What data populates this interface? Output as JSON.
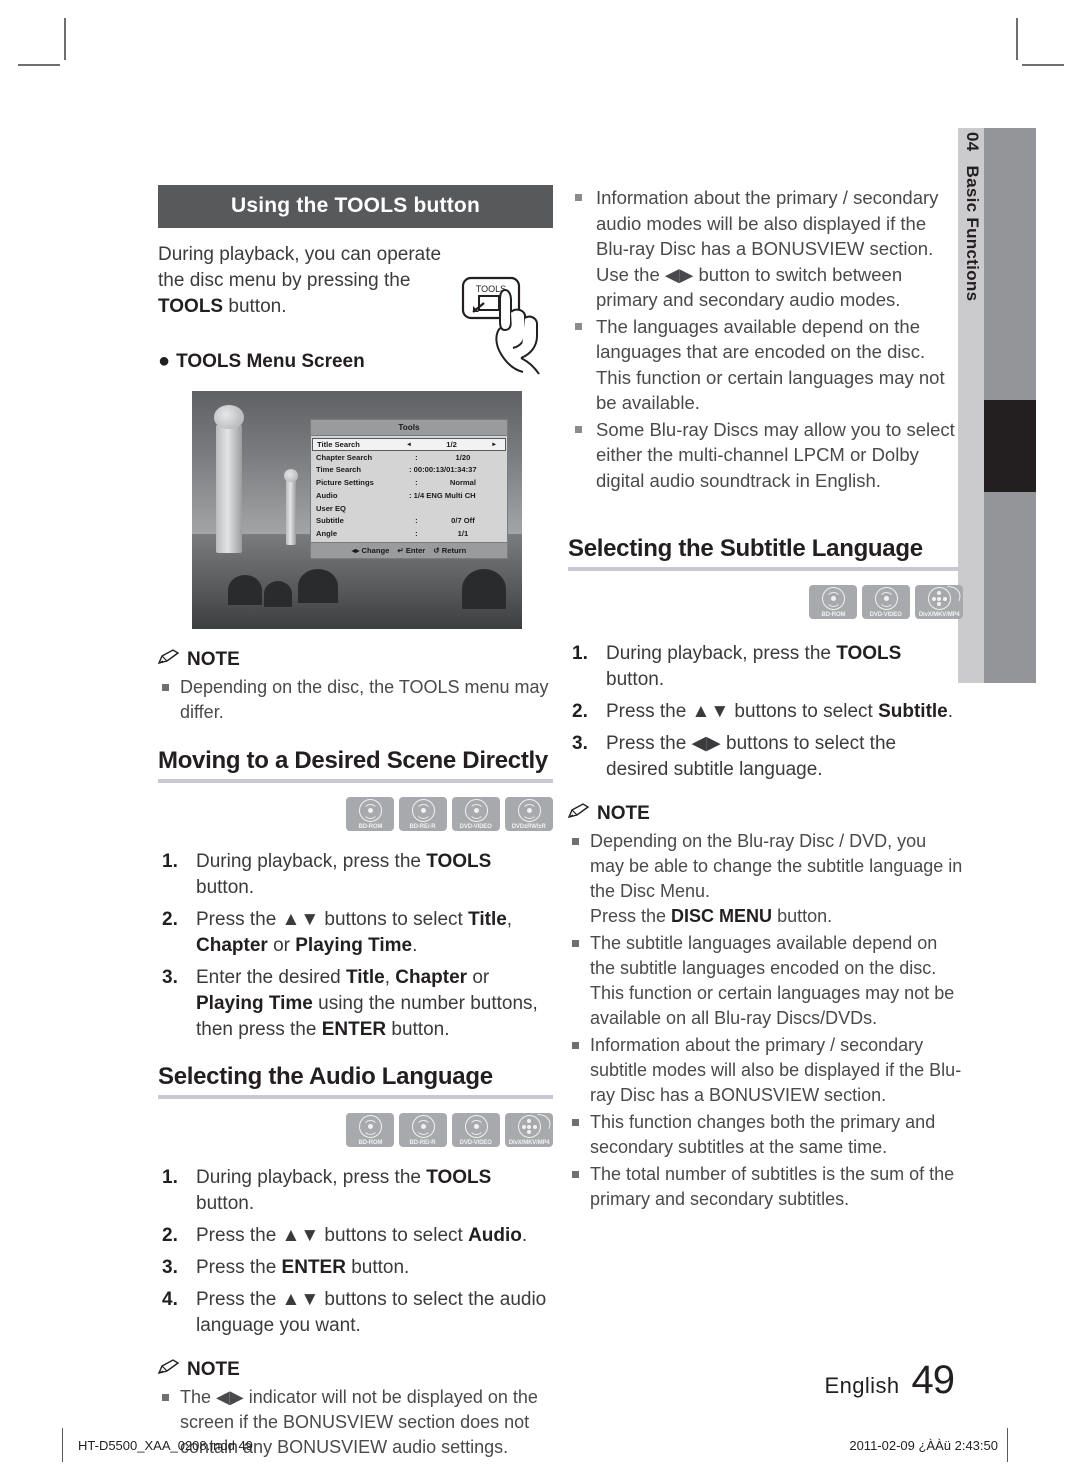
{
  "side_tab": {
    "number": "04",
    "label": "Basic Functions"
  },
  "left_column": {
    "bar_heading": "Using the TOOLS button",
    "intro_paragraph_1": "During playback, you can operate the disc menu by pressing the ",
    "intro_bold": "TOOLS",
    "intro_paragraph_2": " button.",
    "remote_button_label": "TOOLS",
    "sub_bullet": "TOOLS Menu Screen",
    "osd": {
      "title": "Tools",
      "rows": [
        {
          "label": "Title Search",
          "colon": "◂",
          "value": "1/2",
          "right_arrow": "▸",
          "selected": true
        },
        {
          "label": "Chapter Search",
          "colon": ":",
          "value": "1/20",
          "selected": false
        },
        {
          "label": "Time Search",
          "colon": "",
          "value": ": 00:00:13/01:34:37",
          "wide": true,
          "selected": false
        },
        {
          "label": "Picture Settings",
          "colon": ":",
          "value": "Normal",
          "selected": false
        },
        {
          "label": "Audio",
          "colon": "",
          "value": ": 1/4 ENG Multi CH",
          "wide": true,
          "selected": false
        },
        {
          "label": "User EQ",
          "colon": "",
          "value": "",
          "selected": false
        },
        {
          "label": "Subtitle",
          "colon": ":",
          "value": "0/7 Off",
          "selected": false
        },
        {
          "label": "Angle",
          "colon": ":",
          "value": "1/1",
          "selected": false
        }
      ],
      "footer_change": "◂▸ Change",
      "footer_enter": "↵ Enter",
      "footer_return": "↺ Return"
    },
    "note_1": {
      "title": "NOTE",
      "items": [
        "Depending on the disc, the TOOLS menu may differ."
      ]
    },
    "heading_moving": "Moving to a Desired Scene Directly",
    "discs_moving": [
      {
        "caption": "BD-ROM",
        "type": "disc"
      },
      {
        "caption": "BD-RE/-R",
        "type": "disc"
      },
      {
        "caption": "DVD-VIDEO",
        "type": "disc"
      },
      {
        "caption": "DVD±RW/±R",
        "type": "disc"
      }
    ],
    "steps_moving": [
      {
        "num": "1.",
        "html": "During playback, press the <b>TOOLS</b> button."
      },
      {
        "num": "2.",
        "html": "Press the ▲▼ buttons to select <b>Title</b>, <b>Chapter</b> or <b>Playing Time</b>."
      },
      {
        "num": "3.",
        "html": "Enter the desired <b>Title</b>, <b>Chapter</b> or <b>Playing Time</b> using the number buttons, then press the <b>ENTER</b> button."
      }
    ],
    "heading_audio": "Selecting the Audio Language",
    "discs_audio": [
      {
        "caption": "BD-ROM",
        "type": "disc"
      },
      {
        "caption": "BD-RE/-R",
        "type": "disc"
      },
      {
        "caption": "DVD-VIDEO",
        "type": "disc"
      },
      {
        "caption": "DivX/MKV/MP4",
        "type": "film"
      }
    ],
    "steps_audio": [
      {
        "num": "1.",
        "html": "During playback, press the <b>TOOLS</b> button."
      },
      {
        "num": "2.",
        "html": "Press the ▲▼ buttons to select <b>Audio</b>."
      },
      {
        "num": "3.",
        "html": "Press the <b>ENTER</b> button."
      },
      {
        "num": "4.",
        "html": "Press the ▲▼ buttons to select the audio language you want."
      }
    ],
    "note_2": {
      "title": "NOTE",
      "items": [
        "The ◀▶ indicator will not be displayed on the screen if the BONUSVIEW section does not contain any BONUSVIEW audio settings."
      ]
    }
  },
  "right_column": {
    "top_bullets": [
      "Information about the primary / secondary audio modes will be also displayed if the Blu-ray Disc has a BONUSVIEW section. Use the ◀▶ button to switch between primary and secondary audio modes.",
      "The languages available depend on the languages that are encoded on the disc. This function or certain languages may not be available.",
      "Some Blu-ray Discs may allow you to select either the multi-channel LPCM or Dolby digital audio soundtrack in English."
    ],
    "heading_subtitle": "Selecting the Subtitle Language",
    "discs_subtitle": [
      {
        "caption": "BD-ROM",
        "type": "disc"
      },
      {
        "caption": "DVD-VIDEO",
        "type": "disc"
      },
      {
        "caption": "DivX/MKV/MP4",
        "type": "film"
      }
    ],
    "steps_subtitle": [
      {
        "num": "1.",
        "html": "During playback, press the <b>TOOLS</b> button."
      },
      {
        "num": "2.",
        "html": "Press the ▲▼ buttons to select <b>Subtitle</b>."
      },
      {
        "num": "3.",
        "html": "Press the ◀▶ buttons to select the desired subtitle language."
      }
    ],
    "note": {
      "title": "NOTE",
      "items_html": [
        "Depending on the Blu-ray Disc / DVD, you may be able to change the subtitle language in the Disc Menu.<br>Press the <b>DISC MENU</b> button.",
        "The subtitle languages available depend on the subtitle languages encoded on the disc. This function or certain languages may not be available on all Blu-ray Discs/DVDs.",
        "Information about the primary / secondary subtitle modes will also be displayed if the Blu-ray Disc has a BONUSVIEW section.",
        "This function changes both the primary and secondary subtitles at the same time.",
        "The total number of subtitles is the sum of the primary and secondary subtitles."
      ]
    }
  },
  "footer": {
    "language": "English",
    "page_number": "49",
    "file_name": "HT-D5500_XAA_0208.indd   49",
    "print_stamp": "2011-02-09   ¿ÀÀü 2:43:50"
  }
}
